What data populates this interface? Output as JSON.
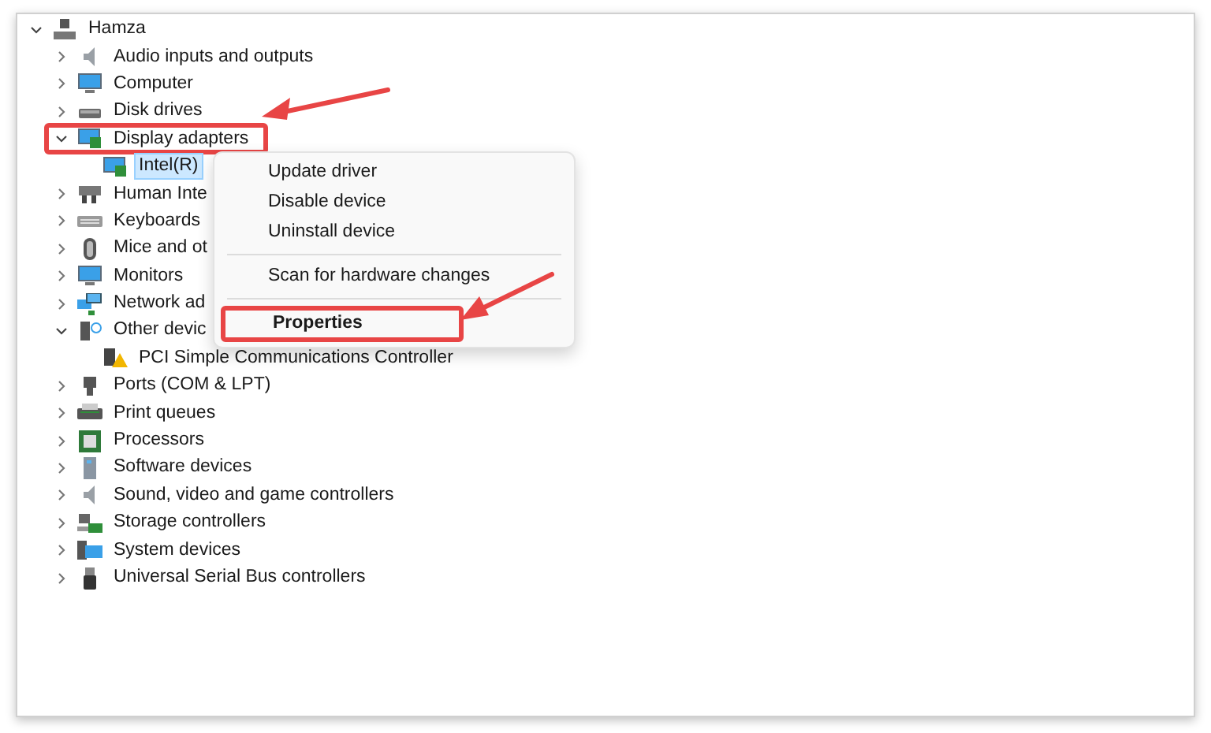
{
  "tree": {
    "label": "Hamza",
    "expanded": true,
    "selected": false,
    "highlighted": false,
    "children": [
      {
        "label": "Audio inputs and outputs",
        "expanded": false,
        "selected": false,
        "highlighted": false
      },
      {
        "label": "Computer",
        "expanded": false,
        "selected": false,
        "highlighted": false
      },
      {
        "label": "Disk drives",
        "expanded": false,
        "selected": false,
        "highlighted": false
      },
      {
        "label": "Display adapters",
        "expanded": true,
        "selected": false,
        "highlighted": true,
        "children": [
          {
            "label": "Intel(R)",
            "selected": true,
            "highlighted": false
          }
        ]
      },
      {
        "label": "Human Inte",
        "expanded": false,
        "selected": false,
        "highlighted": false
      },
      {
        "label": "Keyboards",
        "expanded": false,
        "selected": false,
        "highlighted": false
      },
      {
        "label": "Mice and ot",
        "expanded": false,
        "selected": false,
        "highlighted": false
      },
      {
        "label": "Monitors",
        "expanded": false,
        "selected": false,
        "highlighted": false
      },
      {
        "label": "Network ad",
        "expanded": false,
        "selected": false,
        "highlighted": false
      },
      {
        "label": "Other devic",
        "expanded": true,
        "selected": false,
        "highlighted": false,
        "children": [
          {
            "label": "PCI Simple Communications Controller",
            "selected": false,
            "highlighted": false
          }
        ]
      },
      {
        "label": "Ports (COM & LPT)",
        "expanded": false,
        "selected": false,
        "highlighted": false
      },
      {
        "label": "Print queues",
        "expanded": false,
        "selected": false,
        "highlighted": false
      },
      {
        "label": "Processors",
        "expanded": false,
        "selected": false,
        "highlighted": false
      },
      {
        "label": "Software devices",
        "expanded": false,
        "selected": false,
        "highlighted": false
      },
      {
        "label": "Sound, video and game controllers",
        "expanded": false,
        "selected": false,
        "highlighted": false
      },
      {
        "label": "Storage controllers",
        "expanded": false,
        "selected": false,
        "highlighted": false
      },
      {
        "label": "System devices",
        "expanded": false,
        "selected": false,
        "highlighted": false
      },
      {
        "label": "Universal Serial Bus controllers",
        "expanded": false,
        "selected": false,
        "highlighted": false
      }
    ]
  },
  "context_menu": {
    "items": [
      {
        "kind": "item",
        "label": "Update driver",
        "default": false,
        "highlighted": false
      },
      {
        "kind": "item",
        "label": "Disable device",
        "default": false,
        "highlighted": false
      },
      {
        "kind": "item",
        "label": "Uninstall device",
        "default": false,
        "highlighted": false
      },
      {
        "kind": "separator"
      },
      {
        "kind": "item",
        "label": "Scan for hardware changes",
        "default": false,
        "highlighted": false
      },
      {
        "kind": "separator"
      },
      {
        "kind": "item",
        "label": "Properties",
        "default": true,
        "highlighted": true
      }
    ]
  }
}
